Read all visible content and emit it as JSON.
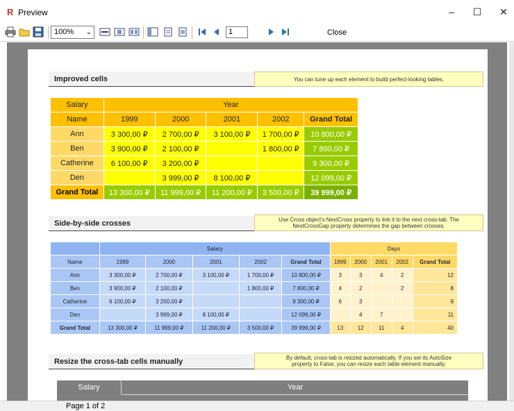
{
  "window": {
    "title": "Preview",
    "app_icon": "R"
  },
  "toolbar": {
    "zoom": "100%",
    "page_input": "1",
    "close_label": "Close",
    "icons": [
      "print-icon",
      "open-icon",
      "save-icon",
      "zoom-dropdown",
      "page-width-icon",
      "whole-page-icon",
      "multi-page-icon",
      "outline-icon",
      "thumbnails-icon",
      "edit-icon",
      "first-page-icon",
      "prev-page-icon",
      "next-page-icon",
      "last-page-icon"
    ]
  },
  "status": {
    "page": "Page 1 of 2"
  },
  "section1": {
    "title": "Improved cells",
    "note": "You can tune up each element to build perfect-looking tables.",
    "table": {
      "corner_top": "Salary",
      "corner_bottom": "Name",
      "year_header": "Year",
      "years": [
        "1999",
        "2000",
        "2001",
        "2002",
        "Grand Total"
      ],
      "rows": [
        {
          "name": "Ann",
          "values": [
            "3 300,00 ₽",
            "2 700,00 ₽",
            "3 100,00 ₽",
            "1 700,00 ₽",
            "10 800,00 ₽"
          ]
        },
        {
          "name": "Ben",
          "values": [
            "3 900,00 ₽",
            "2 100,00 ₽",
            "",
            "1 800,00 ₽",
            "7 800,00 ₽"
          ]
        },
        {
          "name": "Catherine",
          "values": [
            "6 100,00 ₽",
            "3 200,00 ₽",
            "",
            "",
            "9 300,00 ₽"
          ]
        },
        {
          "name": "Den",
          "values": [
            "",
            "3 999,00 ₽",
            "8 100,00 ₽",
            "",
            "12 099,00 ₽"
          ]
        }
      ],
      "total": {
        "name": "Grand Total",
        "values": [
          "13 300,00 ₽",
          "11 999,00 ₽",
          "11 200,00 ₽",
          "3 500,00 ₽",
          "39 999,00 ₽"
        ]
      }
    }
  },
  "section2": {
    "title": "Side-by-side crosses",
    "note_line1": "Use Cross object's NextCross property to link it to the next cross-tab. The",
    "note_line2": "NextCrossGap property determines the gap between crosses.",
    "table": {
      "salary_header": "Salary",
      "days_header": "Days",
      "name_header": "Name",
      "years": [
        "1999",
        "2000",
        "2001",
        "2002",
        "Grand Total"
      ],
      "rows": [
        {
          "name": "Ann",
          "salary": [
            "3 300,00 ₽",
            "2 700,00 ₽",
            "3 100,00 ₽",
            "1 700,00 ₽",
            "10 800,00 ₽"
          ],
          "days": [
            "3",
            "3",
            "4",
            "2",
            "12"
          ]
        },
        {
          "name": "Ben",
          "salary": [
            "3 900,00 ₽",
            "2 100,00 ₽",
            "",
            "1 800,00 ₽",
            "7 800,00 ₽"
          ],
          "days": [
            "4",
            "2",
            "",
            "2",
            "8"
          ]
        },
        {
          "name": "Catherine",
          "salary": [
            "6 100,00 ₽",
            "3 200,00 ₽",
            "",
            "",
            "9 300,00 ₽"
          ],
          "days": [
            "6",
            "3",
            "",
            "",
            "9"
          ]
        },
        {
          "name": "Den",
          "salary": [
            "",
            "3 999,00 ₽",
            "8 100,00 ₽",
            "",
            "12 099,00 ₽"
          ],
          "days": [
            "",
            "4",
            "7",
            "",
            "11"
          ]
        }
      ],
      "total": {
        "name": "Grand Total",
        "salary": [
          "13 300,00 ₽",
          "11 999,00 ₽",
          "11 200,00 ₽",
          "3 500,00 ₽",
          "39 999,00 ₽"
        ],
        "days": [
          "13",
          "12",
          "11",
          "4",
          "40"
        ]
      }
    }
  },
  "section3": {
    "title": "Resize the cross-tab cells manually",
    "note_line1": "By default, cross-tab is resized automatically. If you set its AutoSize",
    "note_line2": "property to False, you can resize each table element manually.",
    "table": {
      "c1": "Salary",
      "c2": "Year"
    }
  }
}
